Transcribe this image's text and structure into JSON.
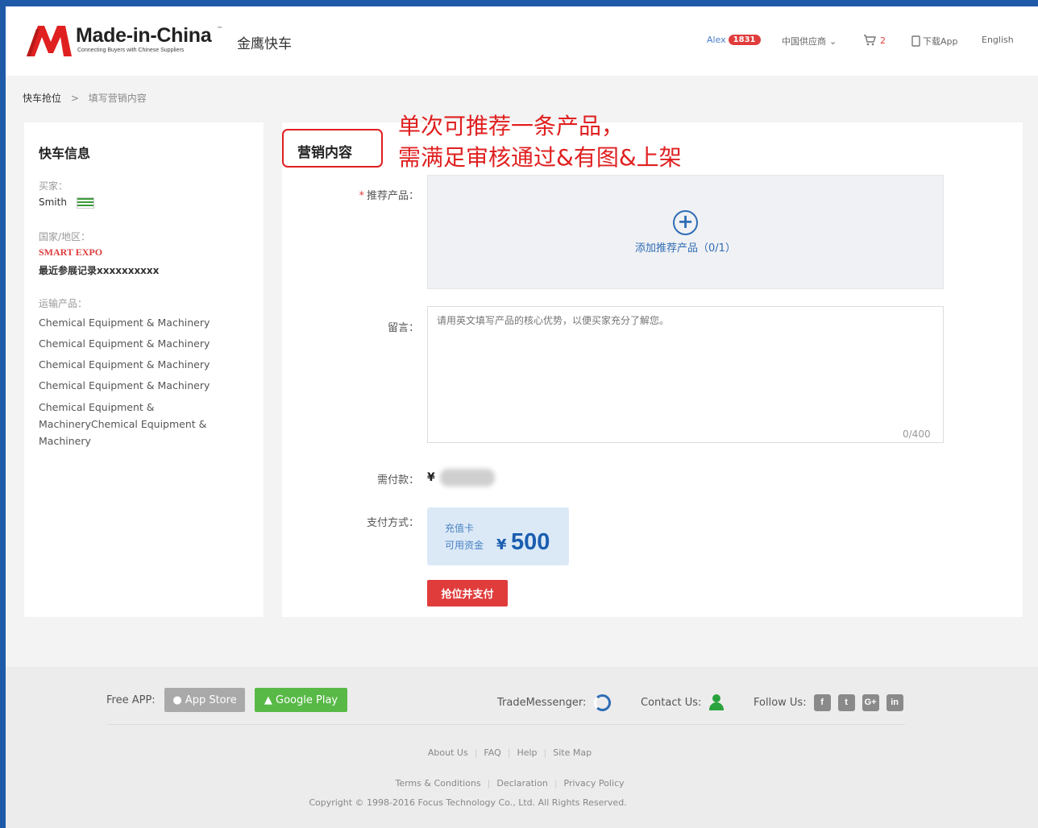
{
  "header": {
    "brand": "Made-in-China",
    "brand_tm": "™",
    "tagline": "Connecting Buyers with Chinese Suppliers",
    "subbrand": "金鹰快车",
    "user": "Alex",
    "badge_count": "1831",
    "supplier_menu": "中国供应商",
    "cart_count": "2",
    "download_app": "下载App",
    "language": "English"
  },
  "breadcrumb": {
    "root": "快车抢位",
    "separator": ">",
    "current": "填写营销内容"
  },
  "left_panel": {
    "title": "快车信息",
    "buyer_label": "买家：",
    "buyer_name": "Smith",
    "country_label": "国家/地区：",
    "expo": "SMART EXPO",
    "recent": "最近参展记录xxxxxxxxxx",
    "products_label": "运输产品：",
    "products": [
      "Chemical Equipment & Machinery",
      "Chemical Equipment & Machinery",
      "Chemical Equipment & Machinery",
      "Chemical Equipment & Machinery"
    ],
    "products_last": "Chemical Equipment & MachineryChemical Equipment & Machinery"
  },
  "main_panel": {
    "section_title": "营销内容",
    "annotation_line1": "单次可推荐一条产品，",
    "annotation_line2": "需满足审核通过&有图&上架",
    "recommend_label": "推荐产品：",
    "required_mark": "*",
    "add_product_link": "添加推荐产品（0/1）",
    "message_label": "留言：",
    "message_placeholder": "请用英文填写产品的核心优势，以便买家充分了解您。",
    "message_counter": "0/400",
    "payable_label": "需付款：",
    "currency": "¥",
    "payment_label": "支付方式：",
    "card_type": "充值卡",
    "available_label": "可用资金",
    "available_currency": "¥",
    "available_amount": "500",
    "pay_button": "抢位并支付"
  },
  "footer": {
    "free_app_label": "Free APP:",
    "app_store": "App Store",
    "google_play": "Google Play",
    "trade_messenger": "TradeMessenger:",
    "contact_us": "Contact Us:",
    "follow_us": "Follow Us:",
    "social": [
      "f",
      "t",
      "G+",
      "in"
    ],
    "links_row1": [
      "About Us",
      "FAQ",
      "Help",
      "Site Map"
    ],
    "links_row2": [
      "Terms & Conditions",
      "Declaration",
      "Privacy Policy"
    ],
    "copyright": "Copyright © 1998-2016 Focus Technology Co., Ltd. All Rights Reserved."
  }
}
